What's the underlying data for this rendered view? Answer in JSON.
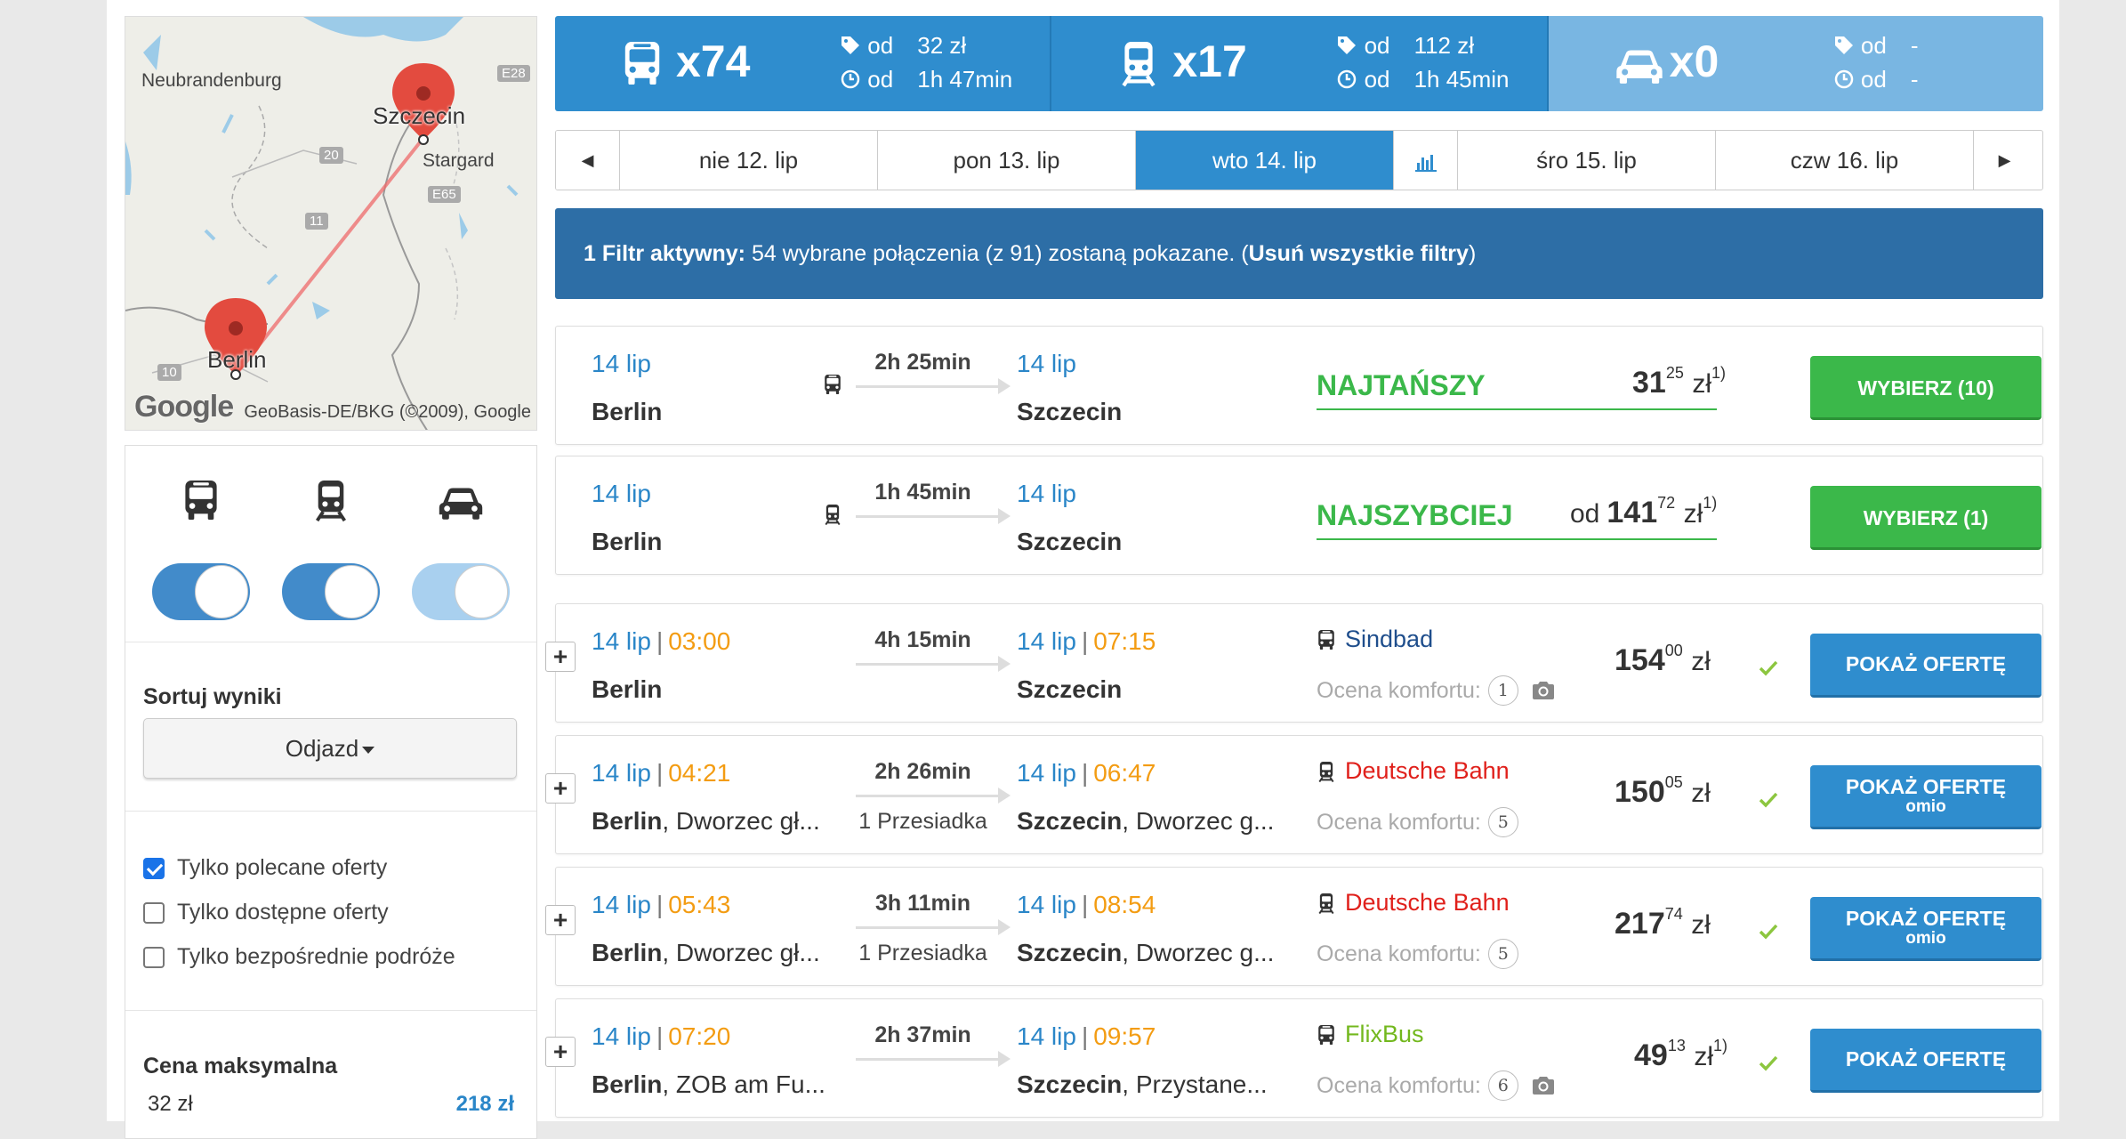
{
  "map": {
    "labels": {
      "neubrandenburg": "Neubrandenburg",
      "szczecin": "Szczecin",
      "stargard": "Stargard",
      "berlin": "Berlin"
    },
    "roads": [
      "E28",
      "20",
      "E65",
      "11",
      "10"
    ],
    "google_logo": "Google",
    "attribution": "GeoBasis-DE/BKG (©2009), Google"
  },
  "sidebar": {
    "sort_label": "Sortuj wyniki",
    "sort_value": "Odjazd",
    "checks": [
      {
        "label": "Tylko polecane oferty",
        "checked": true
      },
      {
        "label": "Tylko dostępne oferty",
        "checked": false
      },
      {
        "label": "Tylko bezpośrednie podróże",
        "checked": false
      }
    ],
    "price_label": "Cena maksymalna",
    "price_min": "32 zł",
    "price_max": "218 zł"
  },
  "summary": [
    {
      "mode": "bus",
      "count": "x74",
      "od1": "od",
      "price": "32 zł",
      "od2": "od",
      "duration": "1h 47min"
    },
    {
      "mode": "train",
      "count": "x17",
      "od1": "od",
      "price": "112 zł",
      "od2": "od",
      "duration": "1h 45min"
    },
    {
      "mode": "car",
      "count": "x0",
      "od1": "od",
      "price": "-",
      "od2": "od",
      "duration": "-"
    }
  ],
  "dates": {
    "tabs": [
      "nie 12. lip",
      "pon 13. lip",
      "wto 14. lip",
      "śro 15. lip",
      "czw 16. lip"
    ],
    "active_index": 2
  },
  "banner": {
    "bold": "1 Filtr aktywny:",
    "text": " 54 wybrane połączenia (z 91) zostaną pokazane. (",
    "link": "Usuń wszystkie filtry",
    "close": ")"
  },
  "highlights": [
    {
      "dep_date": "14 lip",
      "dep_city": "Berlin",
      "duration": "2h 25min",
      "arr_date": "14 lip",
      "arr_city": "Szczecin",
      "tag": "NAJTAŃSZY",
      "od": "",
      "price_int": "31",
      "price_dec": "25",
      "currency": "zł",
      "note": "1)",
      "button": "WYBIERZ (10)",
      "mode": "bus"
    },
    {
      "dep_date": "14 lip",
      "dep_city": "Berlin",
      "duration": "1h 45min",
      "arr_date": "14 lip",
      "arr_city": "Szczecin",
      "tag": "NAJSZYBCIEJ",
      "od": "od",
      "price_int": "141",
      "price_dec": "72",
      "currency": "zł",
      "note": "1)",
      "button": "WYBIERZ (1)",
      "mode": "train"
    }
  ],
  "results": [
    {
      "dep_date": "14 lip",
      "dep_time": "03:00",
      "dep_city": "Berlin",
      "dep_station": "",
      "duration": "4h 15min",
      "transfer": "",
      "arr_date": "14 lip",
      "arr_time": "07:15",
      "arr_city": "Szczecin",
      "arr_station": "",
      "mode": "bus",
      "operator": "Sindbad",
      "operator_color": "#1f4e8c",
      "comfort_label": "Ocena komfortu:",
      "comfort": "1",
      "camera": true,
      "price_int": "154",
      "price_dec": "00",
      "currency": "zł",
      "note": "",
      "button": "POKAŻ OFERTĘ",
      "button_sub": ""
    },
    {
      "dep_date": "14 lip",
      "dep_time": "04:21",
      "dep_city": "Berlin",
      "dep_station": ", Dworzec gł...",
      "duration": "2h 26min",
      "transfer": "1 Przesiadka",
      "arr_date": "14 lip",
      "arr_time": "06:47",
      "arr_city": "Szczecin",
      "arr_station": ", Dworzec g...",
      "mode": "train",
      "operator": "Deutsche Bahn",
      "operator_color": "#e0201b",
      "comfort_label": "Ocena komfortu:",
      "comfort": "5",
      "camera": false,
      "price_int": "150",
      "price_dec": "05",
      "currency": "zł",
      "note": "",
      "button": "POKAŻ OFERTĘ",
      "button_sub": "omio"
    },
    {
      "dep_date": "14 lip",
      "dep_time": "05:43",
      "dep_city": "Berlin",
      "dep_station": ", Dworzec gł...",
      "duration": "3h 11min",
      "transfer": "1 Przesiadka",
      "arr_date": "14 lip",
      "arr_time": "08:54",
      "arr_city": "Szczecin",
      "arr_station": ", Dworzec g...",
      "mode": "train",
      "operator": "Deutsche Bahn",
      "operator_color": "#e0201b",
      "comfort_label": "Ocena komfortu:",
      "comfort": "5",
      "camera": false,
      "price_int": "217",
      "price_dec": "74",
      "currency": "zł",
      "note": "",
      "button": "POKAŻ OFERTĘ",
      "button_sub": "omio"
    },
    {
      "dep_date": "14 lip",
      "dep_time": "07:20",
      "dep_city": "Berlin",
      "dep_station": ", ZOB am Fu...",
      "duration": "2h 37min",
      "transfer": "",
      "arr_date": "14 lip",
      "arr_time": "09:57",
      "arr_city": "Szczecin",
      "arr_station": ", Przystane...",
      "mode": "bus",
      "operator": "FlixBus",
      "operator_color": "#73b81e",
      "comfort_label": "Ocena komfortu:",
      "comfort": "6",
      "camera": true,
      "price_int": "49",
      "price_dec": "13",
      "currency": "zł",
      "note": "1)",
      "button": "POKAŻ OFERTĘ",
      "button_sub": ""
    }
  ]
}
